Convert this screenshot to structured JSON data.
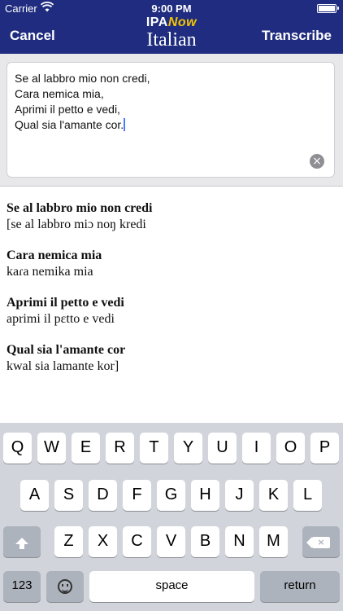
{
  "status_bar": {
    "carrier": "Carrier",
    "time": "9:00 PM"
  },
  "nav": {
    "cancel_label": "Cancel",
    "transcribe_label": "Transcribe",
    "logo_ipa": "IPA",
    "logo_now": "Now",
    "language": "Italian"
  },
  "input": {
    "lines": [
      "Se al labbro mio non credi,",
      "Cara nemica mia,",
      "Aprimi il petto e vedi,",
      "Qual sia l'amante cor."
    ]
  },
  "results": [
    {
      "original": "Se al labbro mio non credi",
      "ipa": "[se al labbro miɔ noŋ kredi"
    },
    {
      "original": "Cara nemica mia",
      "ipa": "kaɾa nemika mia"
    },
    {
      "original": "Aprimi il petto e vedi",
      "ipa": "aprimi il pɛtto e vedi"
    },
    {
      "original": "Qual sia l'amante cor",
      "ipa": "kwal sia lamante kor]"
    }
  ],
  "keyboard": {
    "row1": [
      "Q",
      "W",
      "E",
      "R",
      "T",
      "Y",
      "U",
      "I",
      "O",
      "P"
    ],
    "row2": [
      "A",
      "S",
      "D",
      "F",
      "G",
      "H",
      "J",
      "K",
      "L"
    ],
    "row3": [
      "Z",
      "X",
      "C",
      "V",
      "B",
      "N",
      "M"
    ],
    "numbers_label": "123",
    "space_label": "space",
    "return_label": "return"
  },
  "colors": {
    "nav_bar": "#1f2c7f",
    "logo_accent": "#f2c500",
    "keyboard_bg": "#d1d5db"
  },
  "icons": {
    "wifi": "wifi-icon",
    "battery": "battery-icon",
    "clear": "clear-icon",
    "shift": "shift-icon",
    "delete": "backspace-icon",
    "emoji": "emoji-icon"
  }
}
